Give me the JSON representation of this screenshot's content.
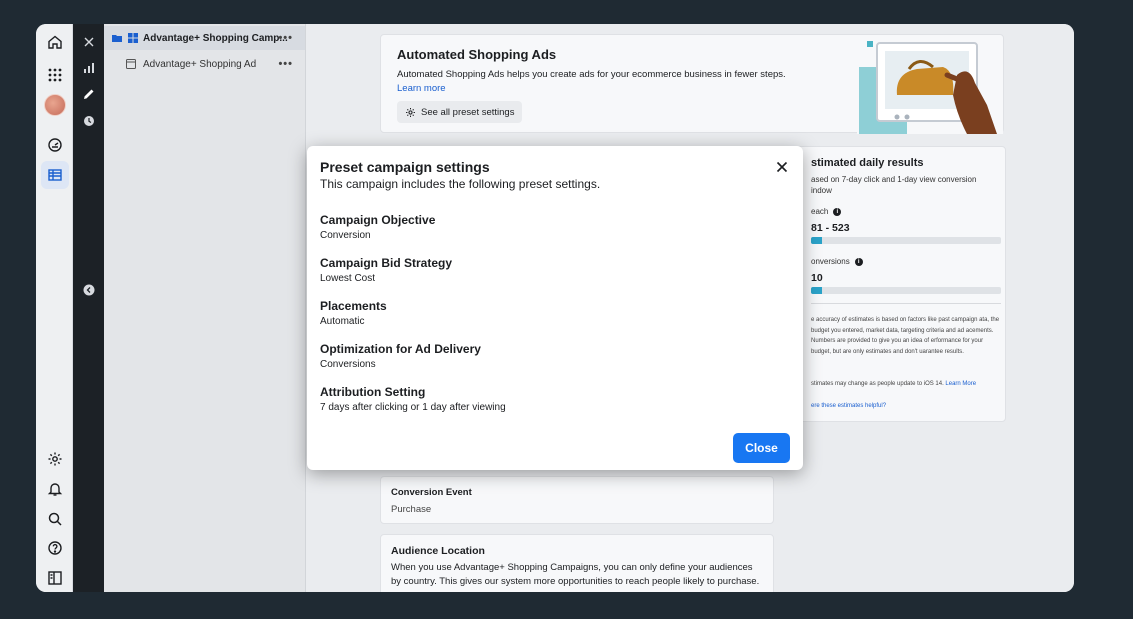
{
  "tree": {
    "campaign_label": "Advantage+ Shopping Camp...",
    "ad_label": "Advantage+ Shopping Ad",
    "more_label": "•••"
  },
  "automated": {
    "title": "Automated Shopping Ads",
    "description": "Automated Shopping Ads helps you create ads for your ecommerce business in fewer steps.",
    "learn_more": "Learn more",
    "preset_button": "See all preset settings"
  },
  "estimates": {
    "title": "stimated daily results",
    "subtitle": "ased on 7-day click and 1-day view conversion indow",
    "reach_label": "each",
    "reach_value": "81 - 523",
    "reach_fill": 0.06,
    "conversions_label": "onversions",
    "conversions_value": "10",
    "conversions_fill": 0.06,
    "note": "e accuracy of estimates is based on factors like past campaign ata, the budget you entered, market data, targeting criteria and ad acements. Numbers are provided to give you an idea of erformance for your budget, but are only estimates and don't uarantee results.",
    "ios_note": "stimates may change as people update to iOS 14.",
    "ios_learn_more": "Learn More",
    "helpful": "ere these estimates helpful?"
  },
  "conversion": {
    "title": "Conversion Event",
    "value": "Purchase"
  },
  "audience": {
    "title": "Audience Location",
    "description": "When you use Advantage+ Shopping Campaigns, you can only define your audiences by country. This gives our system more opportunities to reach people likely to purchase."
  },
  "modal": {
    "title": "Preset campaign settings",
    "subtitle": "This campaign includes the following preset settings.",
    "settings": [
      {
        "label": "Campaign Objective",
        "value": "Conversion"
      },
      {
        "label": "Campaign Bid Strategy",
        "value": "Lowest Cost"
      },
      {
        "label": "Placements",
        "value": "Automatic"
      },
      {
        "label": "Optimization for Ad Delivery",
        "value": "Conversions"
      },
      {
        "label": "Attribution Setting",
        "value": "7 days after clicking or 1 day after viewing"
      }
    ],
    "close_button": "Close"
  },
  "colors": {
    "primary": "#1877f2",
    "link": "#1a5fcf",
    "bar_fill": "#2ba3c9"
  },
  "icons": {
    "rail": [
      "home-icon",
      "apps-grid-icon",
      "avatar",
      "dashboard-icon",
      "table-icon",
      "settings-icon",
      "notifications-icon",
      "search-icon",
      "help-icon",
      "panel-toggle-icon"
    ],
    "strip": [
      "close-icon",
      "chart-icon",
      "edit-icon",
      "history-icon",
      "collapse-icon"
    ]
  }
}
